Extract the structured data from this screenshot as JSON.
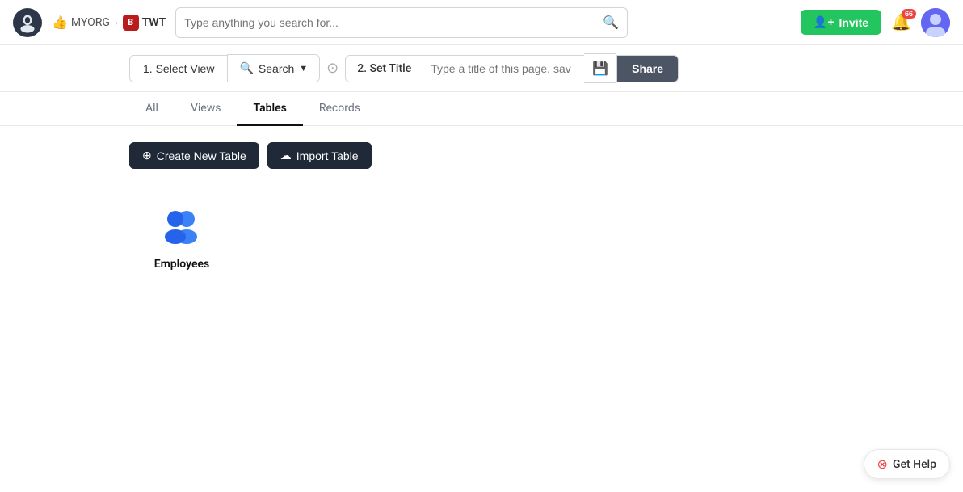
{
  "header": {
    "org_name": "MYORG",
    "project_name": "TWT",
    "project_badge": "B",
    "search_placeholder": "Type anything you search for...",
    "invite_label": "Invite",
    "notif_count": "66"
  },
  "toolbar": {
    "select_view_label": "1. Select View",
    "search_label": "Search",
    "set_title_label": "2. Set Title",
    "title_placeholder": "Type a title of this page, sav",
    "share_label": "Share"
  },
  "tabs": [
    {
      "id": "all",
      "label": "All"
    },
    {
      "id": "views",
      "label": "Views"
    },
    {
      "id": "tables",
      "label": "Tables"
    },
    {
      "id": "records",
      "label": "Records"
    }
  ],
  "active_tab": "tables",
  "buttons": {
    "create_table": "Create New Table",
    "import_table": "Import Table"
  },
  "tables": [
    {
      "name": "Employees"
    }
  ],
  "get_help_label": "Get Help"
}
